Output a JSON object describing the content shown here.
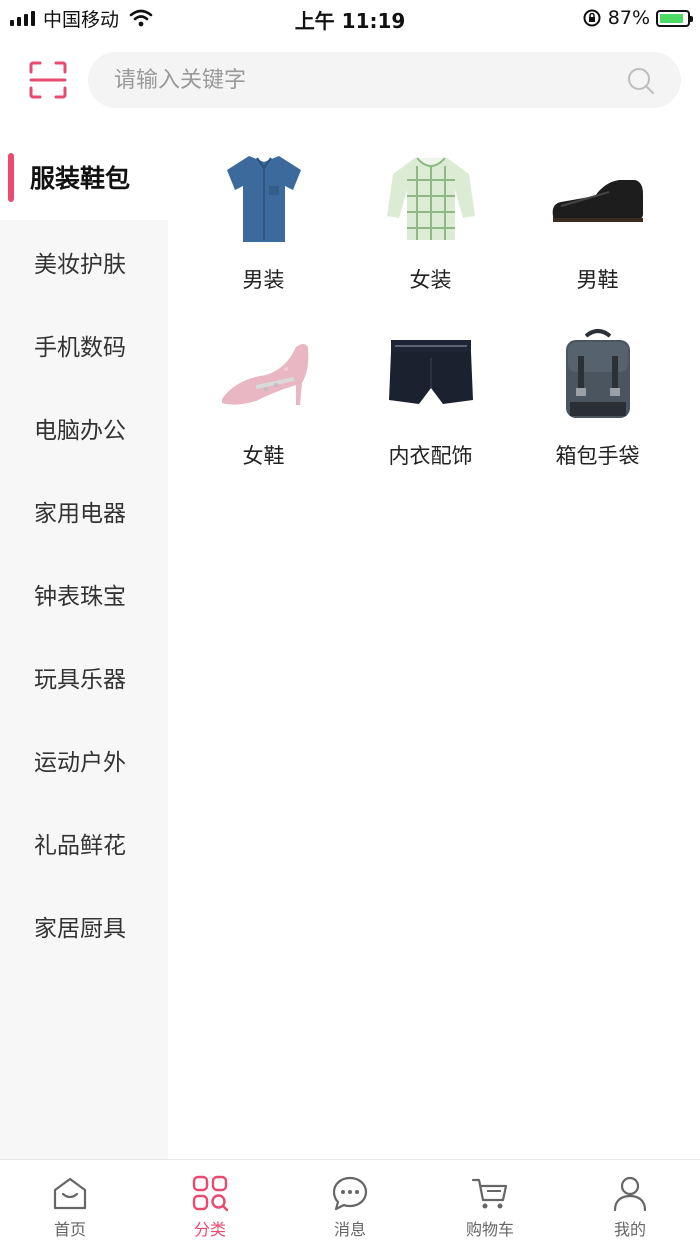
{
  "status_bar": {
    "carrier": "中国移动",
    "time": "上午 11:19",
    "battery_percent": "87%",
    "battery_level": 0.87
  },
  "search": {
    "placeholder": "请输入关键字",
    "value": ""
  },
  "sidebar": {
    "active_index": 0,
    "items": [
      {
        "label": "服装鞋包"
      },
      {
        "label": "美妆护肤"
      },
      {
        "label": "手机数码"
      },
      {
        "label": "电脑办公"
      },
      {
        "label": "家用电器"
      },
      {
        "label": "钟表珠宝"
      },
      {
        "label": "玩具乐器"
      },
      {
        "label": "运动户外"
      },
      {
        "label": "礼品鲜花"
      },
      {
        "label": "家居厨具"
      }
    ]
  },
  "products": [
    {
      "label": "男装",
      "icon": "mens-shirt-icon"
    },
    {
      "label": "女装",
      "icon": "womens-blouse-icon"
    },
    {
      "label": "男鞋",
      "icon": "mens-shoe-icon"
    },
    {
      "label": "女鞋",
      "icon": "high-heel-icon"
    },
    {
      "label": "内衣配饰",
      "icon": "underwear-icon"
    },
    {
      "label": "箱包手袋",
      "icon": "backpack-icon"
    }
  ],
  "tabbar": {
    "active_index": 1,
    "items": [
      {
        "label": "首页",
        "icon": "home-icon"
      },
      {
        "label": "分类",
        "icon": "category-icon"
      },
      {
        "label": "消息",
        "icon": "message-icon"
      },
      {
        "label": "购物车",
        "icon": "cart-icon"
      },
      {
        "label": "我的",
        "icon": "user-icon"
      }
    ]
  },
  "colors": {
    "accent": "#e94a70",
    "sidebar_bg": "#f7f7f7",
    "search_bg": "#f4f4f4"
  }
}
